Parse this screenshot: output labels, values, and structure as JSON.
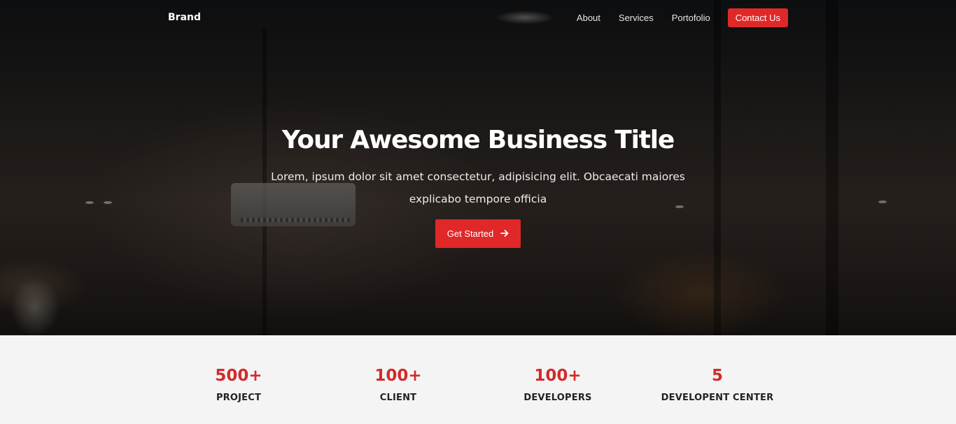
{
  "navbar": {
    "brand": "Brand",
    "links": [
      "About",
      "Services",
      "Portofolio"
    ],
    "cta": "Contact Us"
  },
  "hero": {
    "title": "Your Awesome Business Title",
    "subtitle": "Lorem, ipsum dolor sit amet consectetur, adipisicing elit. Obcaecati maiores explicabo tempore officia",
    "button_label": "Get Started",
    "button_icon": "arrow-right-icon"
  },
  "stats": [
    {
      "value": "500+",
      "label": "PROJECT"
    },
    {
      "value": "100+",
      "label": "CLIENT"
    },
    {
      "value": "100+",
      "label": "DEVELOPERS"
    },
    {
      "value": "5",
      "label": "DEVELOPENT CENTER"
    }
  ],
  "colors": {
    "accent": "#e02828",
    "stat_value": "#d32a2a",
    "stats_background": "#f4f4f4"
  }
}
